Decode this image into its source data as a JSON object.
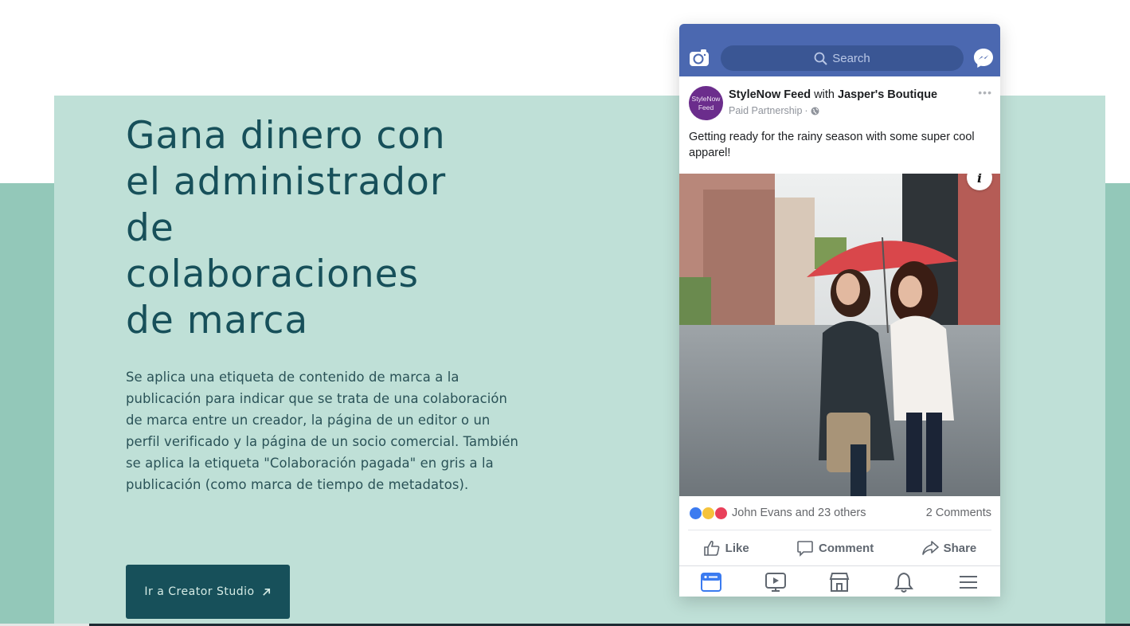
{
  "hero": {
    "headline_lines": [
      "Gana dinero con",
      "el administrador",
      "de",
      "colaboraciones",
      "de marca"
    ],
    "body": "Se aplica una etiqueta de contenido de marca a la publicación para indicar que se trata de una colaboración de marca entre un creador, la página de un editor o un perfil verificado y la página de un socio comercial. También se aplica la etiqueta \"Colaboración pagada\" en gris a la publicación (como marca de tiempo de metadatos).",
    "cta_label": "Ir a Creator Studio",
    "cta_icon": "external-arrow-icon"
  },
  "colors": {
    "panel": "#bfe0d7",
    "band": "#93c8b9",
    "headline": "#17505a",
    "cta_bg": "#17505a",
    "facebook_blue": "#4b68b0"
  },
  "phone": {
    "search_placeholder": "Search",
    "icons": {
      "camera": "camera-icon",
      "search": "search-icon",
      "messenger": "messenger-icon"
    },
    "post": {
      "avatar_line1": "StyleNow",
      "avatar_line2": "Feed",
      "author": "StyleNow Feed",
      "with_word": "with",
      "partner": "Jasper's Boutique",
      "subtitle": "Paid Partnership",
      "subtitle_sep": "·",
      "more": "•••",
      "text": "Getting ready for the rainy season with some super cool apparel!",
      "info_glyph": "i",
      "reactions_text": "John Evans and 23 others",
      "comments_text": "2 Comments",
      "actions": {
        "like": "Like",
        "comment": "Comment",
        "share": "Share"
      }
    },
    "tabs": [
      "news-feed",
      "watch",
      "marketplace",
      "notifications",
      "menu"
    ]
  }
}
